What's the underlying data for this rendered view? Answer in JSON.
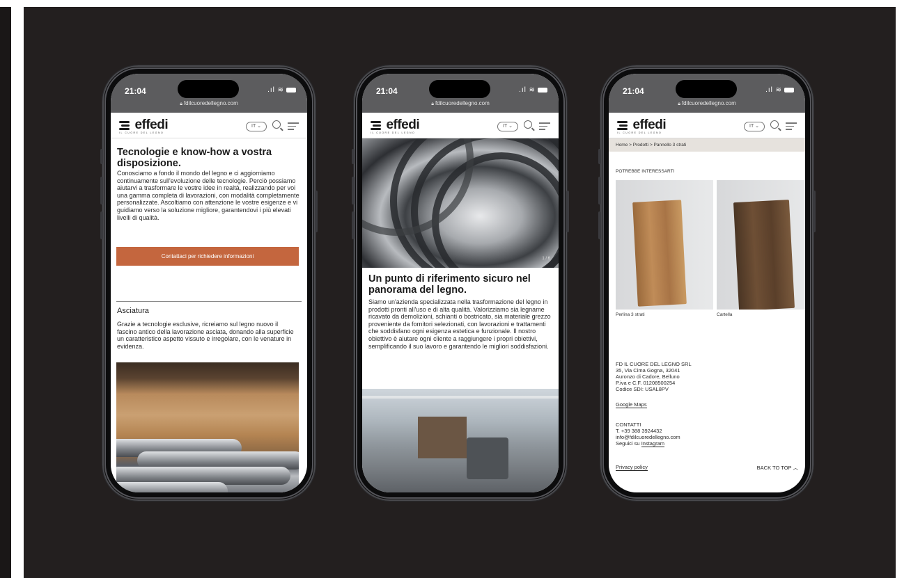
{
  "colors": {
    "background": "#231f1f",
    "accent": "#c4663e",
    "statusbar": "#5c5c5e",
    "crumbs": "#e6e2dd"
  },
  "common": {
    "time": "21:04",
    "url": "fdilcuoredellegno.com",
    "logo_text": "effedi",
    "logo_tagline": "IL CUORE DEL LEGNO",
    "lang": "IT"
  },
  "phone1": {
    "title": "Tecnologie e know-how a vostra disposizione.",
    "intro": "Conosciamo a fondo il mondo del legno e ci aggiorniamo continuamente sull'evoluzione delle tecnologie. Perciò possiamo aiutarvi a trasformare le vostre idee in realtà, realizzando per voi una gamma completa di lavorazioni, con modalità completamente personalizzate. Ascoltiamo con attenzione le vostre esigenze e vi guidiamo verso la soluzione migliore, garantendovi i più elevati livelli di qualità.",
    "cta": "Contattaci per richiedere informazioni",
    "section_title": "Asciatura",
    "section_text": "Grazie a tecnologie esclusive, ricreiamo sul legno nuovo il fascino antico della lavorazione asciata, donando alla superficie un caratteristico aspetto vissuto e irregolare, con le venature in evidenza."
  },
  "phone2": {
    "slide_indicator": "1 / 6",
    "title": "Un punto di riferimento sicuro nel panorama del legno.",
    "text": "Siamo un'azienda specializzata nella trasformazione del legno in prodotti pronti all'uso e di alta qualità. Valorizziamo sia legname ricavato da demolizioni, schianti o bostricato, sia materiale grezzo proveniente da fornitori selezionati, con lavorazioni e trattamenti che soddisfano ogni esigenza estetica e funzionale. Il nostro obiettivo è aiutare ogni cliente a raggiungere i propri obiettivi, semplificando il suo lavoro e garantendo le migliori soddisfazioni."
  },
  "phone3": {
    "breadcrumb": "Home > Prodotti > Pannello 3 strati",
    "related_title": "POTREBBE INTERESSARTI",
    "products": [
      {
        "name": "Perlina 3 strati"
      },
      {
        "name": "Cartella"
      }
    ],
    "company": [
      "FD IL CUORE DEL LEGNO SRL",
      "35, Via Cima Gogna, 32041",
      "Auronzo di Cadore, Belluno",
      "P.iva e C.F. 01208500254",
      "Codice SDI: USAL8PV"
    ],
    "maps_link": "Google Maps",
    "contacts_title": "CONTATTI",
    "phone": "T. +39 388 3924432",
    "email": "info@fdilcuoredellegno.com",
    "follow_prefix": "Seguici su ",
    "instagram": "Instagram",
    "privacy": "Privacy policy",
    "back_to_top": "BACK TO TOP"
  }
}
